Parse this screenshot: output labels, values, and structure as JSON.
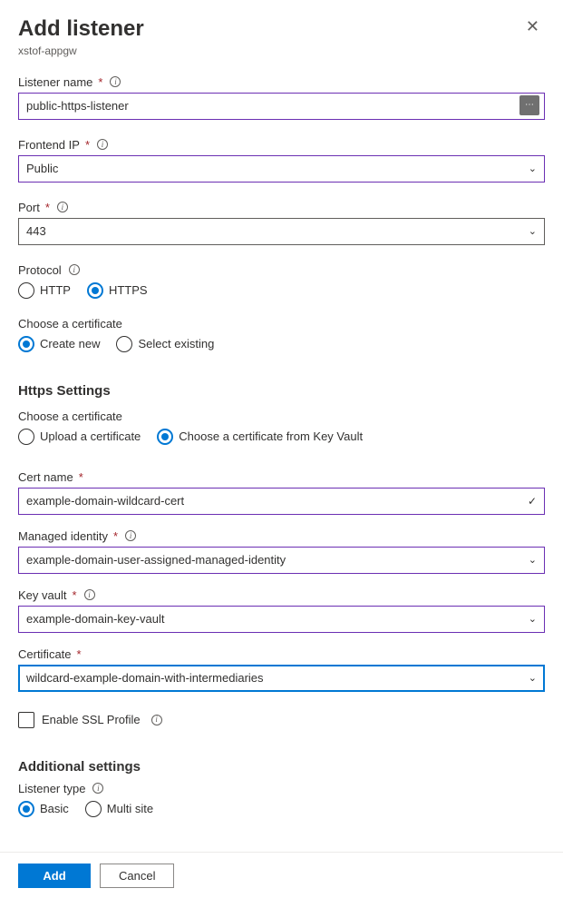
{
  "header": {
    "title": "Add listener",
    "subtitle": "xstof-appgw"
  },
  "fields": {
    "listener_name": {
      "label": "Listener name",
      "value": "public-https-listener"
    },
    "frontend_ip": {
      "label": "Frontend IP",
      "value": "Public"
    },
    "port": {
      "label": "Port",
      "value": "443"
    },
    "protocol": {
      "label": "Protocol",
      "options": {
        "http": "HTTP",
        "https": "HTTPS"
      }
    },
    "choose_cert_mode": {
      "label": "Choose a certificate",
      "options": {
        "create": "Create new",
        "select": "Select existing"
      }
    }
  },
  "https_settings": {
    "heading": "Https Settings",
    "choose_cert_source": {
      "label": "Choose a certificate",
      "options": {
        "upload": "Upload a certificate",
        "keyvault": "Choose a certificate from Key Vault"
      }
    },
    "cert_name": {
      "label": "Cert name",
      "value": "example-domain-wildcard-cert"
    },
    "managed_identity": {
      "label": "Managed identity",
      "value": "example-domain-user-assigned-managed-identity"
    },
    "key_vault": {
      "label": "Key vault",
      "value": "example-domain-key-vault"
    },
    "certificate": {
      "label": "Certificate",
      "value": "wildcard-example-domain-with-intermediaries"
    },
    "enable_ssl": {
      "label": "Enable SSL Profile"
    }
  },
  "additional": {
    "heading": "Additional settings",
    "listener_type": {
      "label": "Listener type",
      "options": {
        "basic": "Basic",
        "multi": "Multi site"
      }
    }
  },
  "footer": {
    "add": "Add",
    "cancel": "Cancel"
  }
}
